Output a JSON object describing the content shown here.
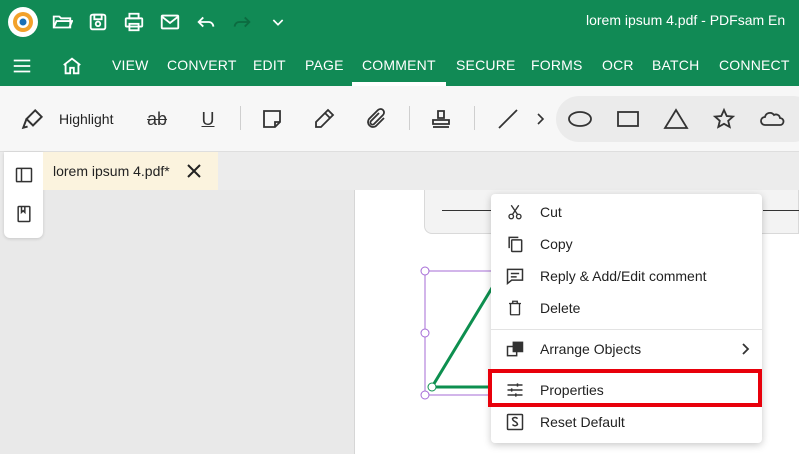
{
  "window": {
    "title": "lorem ipsum 4.pdf  -  PDFsam En"
  },
  "quick_access": {
    "icons": [
      "app-logo-icon",
      "open-folder-icon",
      "save-icon",
      "print-icon",
      "mail-icon",
      "undo-icon",
      "redo-icon",
      "chevron-down-icon"
    ]
  },
  "menu": {
    "items": [
      {
        "label": "VIEW"
      },
      {
        "label": "CONVERT"
      },
      {
        "label": "EDIT"
      },
      {
        "label": "PAGE"
      },
      {
        "label": "COMMENT"
      },
      {
        "label": "SECURE"
      },
      {
        "label": "FORMS"
      },
      {
        "label": "OCR"
      },
      {
        "label": "BATCH"
      },
      {
        "label": "CONNECT"
      }
    ],
    "active": "COMMENT"
  },
  "toolbar": {
    "highlight_label": "Highlight",
    "strike_label": "ab",
    "underline_label": "U"
  },
  "tab": {
    "label": "lorem ipsum 4.pdf*"
  },
  "context_menu": {
    "items": [
      {
        "label": "Cut",
        "icon": "scissors-icon"
      },
      {
        "label": "Copy",
        "icon": "copy-icon"
      },
      {
        "label": "Reply & Add/Edit comment",
        "icon": "comment-icon"
      },
      {
        "label": "Delete",
        "icon": "trash-icon"
      },
      {
        "label": "Arrange Objects",
        "icon": "arrange-icon"
      },
      {
        "label": "Properties",
        "icon": "sliders-icon"
      },
      {
        "label": "Reset Default",
        "icon": "reset-icon"
      }
    ]
  },
  "colors": {
    "brand_green": "#118a55",
    "highlight_red": "#e8000b",
    "selection_purple": "#a56bd6",
    "shape_green": "#0d8f4f"
  }
}
